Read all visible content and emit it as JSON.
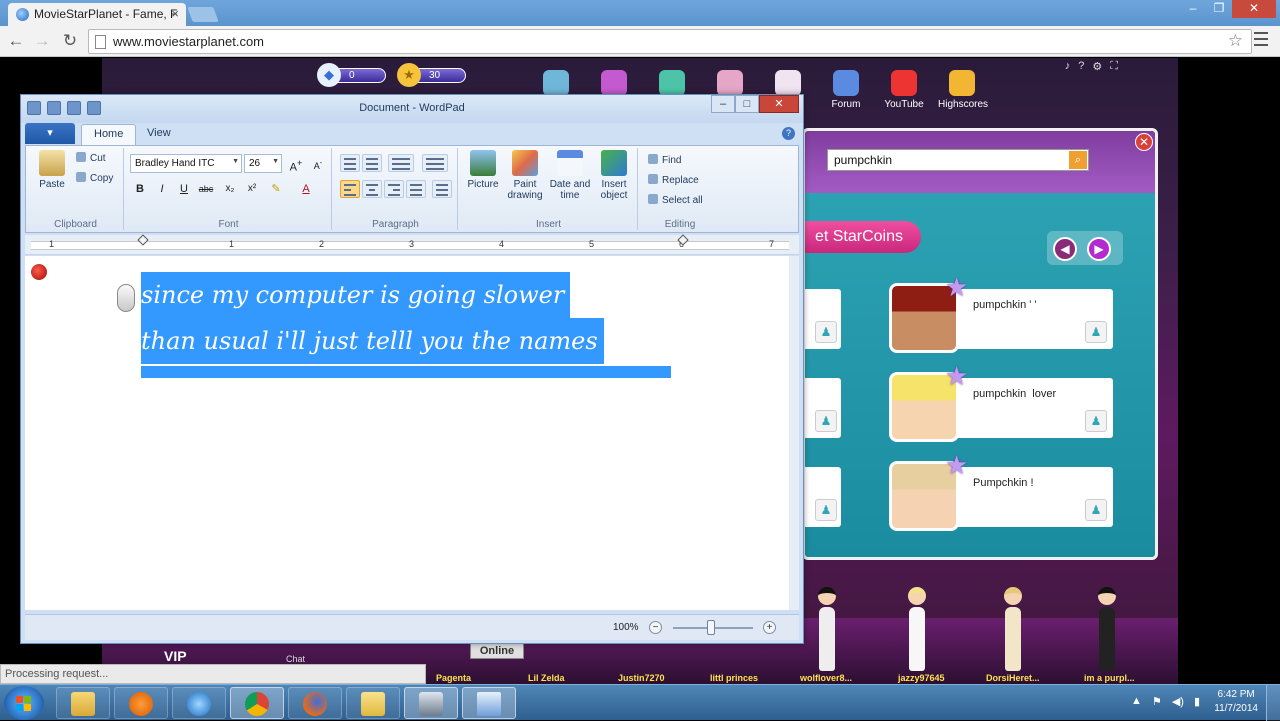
{
  "browser": {
    "tab_title": "MovieStarPlanet - Fame, F",
    "url": "www.moviestarplanet.com",
    "status": "Processing request..."
  },
  "game": {
    "diamonds": "0",
    "starcoins": "30",
    "nav_items": [
      "",
      "",
      "",
      "",
      "",
      "Forum",
      "YouTube",
      "Highscores"
    ],
    "search_value": "pumpchkin",
    "get_starcoins": "et StarCoins",
    "results": [
      {
        "name": "pumpchkin ' '",
        "hair": "#8e1d14",
        "skin": "#c88d62"
      },
      {
        "name": "pumpchkin  lover",
        "hair": "#f5e36a",
        "skin": "#f6d4b0"
      },
      {
        "name": "Pumpchkin !",
        "hair": "#e8cfa0",
        "skin": "#f4d2b2"
      }
    ],
    "vip_label": "VIP",
    "chat_label": "Chat",
    "online_label": "Online",
    "avatar_names": [
      "Pagenta",
      "Lil Zelda",
      "Justin7270",
      "littl princes",
      "wolflover8...",
      "jazzy97645",
      "DorsiHeret...",
      "im a purpl..."
    ]
  },
  "wordpad": {
    "title": "Document - WordPad",
    "tabs": {
      "file": "▾",
      "home": "Home",
      "view": "View"
    },
    "clipboard": {
      "paste": "Paste",
      "cut": "Cut",
      "copy": "Copy",
      "label": "Clipboard"
    },
    "font": {
      "family": "Bradley Hand ITC",
      "size": "26",
      "label": "Font"
    },
    "paragraph": {
      "label": "Paragraph"
    },
    "insert": {
      "picture": "Picture",
      "paint": "Paint drawing",
      "datetime": "Date and time",
      "object": "Insert object",
      "label": "Insert"
    },
    "editing": {
      "find": "Find",
      "replace": "Replace",
      "select_all": "Select all",
      "label": "Editing"
    },
    "document_lines": [
      "since my computer is going slower",
      "than usual i'll just telll you the names"
    ],
    "zoom": "100%",
    "ruler_numbers": [
      "1",
      "1",
      "2",
      "3",
      "4",
      "5",
      "6",
      "7"
    ]
  },
  "taskbar": {
    "time": "6:42 PM",
    "date": "11/7/2014"
  }
}
